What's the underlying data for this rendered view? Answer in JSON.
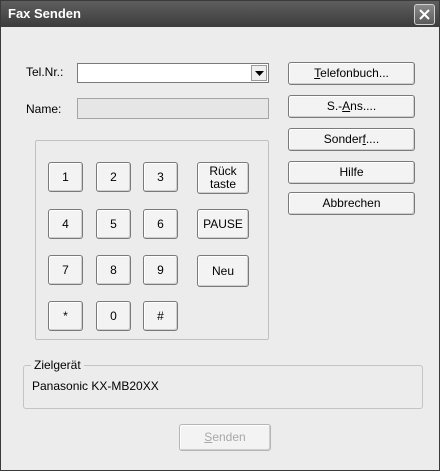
{
  "window": {
    "title": "Fax Senden"
  },
  "form": {
    "tel_label": "Tel.Nr.:",
    "tel_value": "",
    "name_label": "Name:",
    "name_value": ""
  },
  "keypad": {
    "rows": [
      [
        "1",
        "2",
        "3"
      ],
      [
        "4",
        "5",
        "6"
      ],
      [
        "7",
        "8",
        "9"
      ],
      [
        "*",
        "0",
        "#"
      ]
    ],
    "backspace_line1": "Rück",
    "backspace_line2": "taste",
    "pause": "PAUSE",
    "new": "Neu"
  },
  "buttons": {
    "phonebook_first": "T",
    "phonebook_rest": "elefonbuch...",
    "sans_pre": "S.-",
    "sans_ul": "A",
    "sans_post": "ns....",
    "special_pre": "Sonder",
    "special_ul": "f",
    "special_post": "....",
    "help": "Hilfe",
    "cancel": "Abbrechen",
    "send_first": "S",
    "send_rest": "enden"
  },
  "target_device": {
    "title": "Zielgerät",
    "value": "Panasonic KX-MB20XX"
  },
  "icons": {
    "close": "close-icon",
    "dropdown": "chevron-down-icon"
  }
}
